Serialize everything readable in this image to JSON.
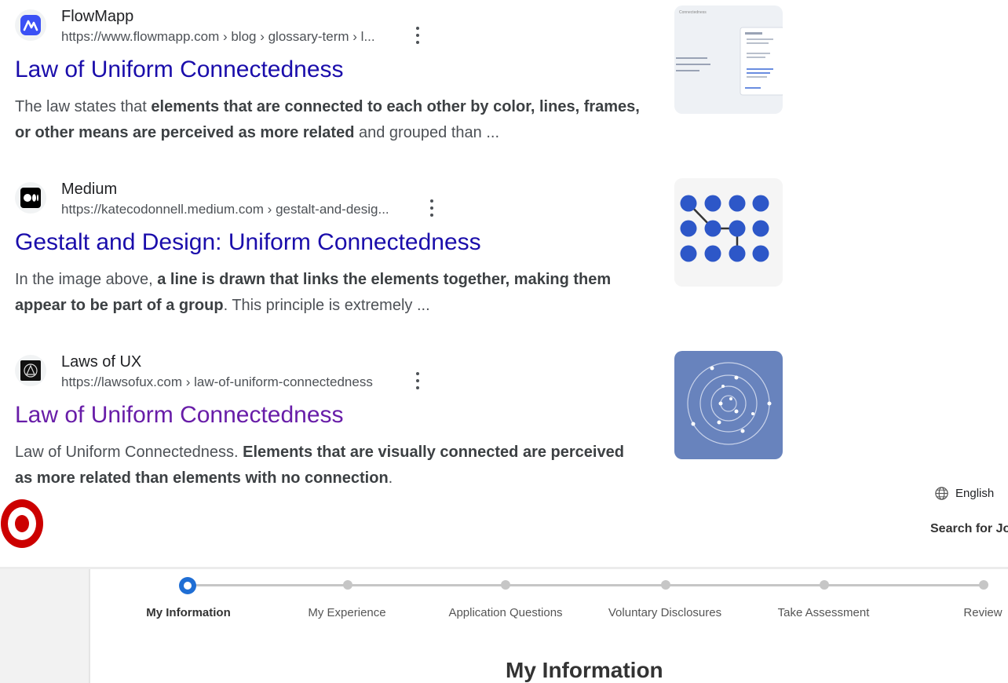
{
  "results": [
    {
      "site_name": "FlowMapp",
      "url": "https://www.flowmapp.com › blog › glossary-term › l...",
      "title": "Law of Uniform Connectedness",
      "snippet": [
        {
          "text": "The law states that ",
          "bold": false
        },
        {
          "text": "elements that are connected to each other by color, lines, frames, or other means are perceived as more related",
          "bold": true
        },
        {
          "text": " and grouped than ...",
          "bold": false
        }
      ],
      "thumb_label": "Connectedness",
      "favicon": "flowmapp-logo-icon",
      "thumbnail": "ui-notifications-screenshot"
    },
    {
      "site_name": "Medium",
      "url": "https://katecodonnell.medium.com › gestalt-and-desig...",
      "title": "Gestalt and Design: Uniform Connectedness",
      "snippet": [
        {
          "text": "In the image above, ",
          "bold": false
        },
        {
          "text": "a line is drawn that links the elements together, making them appear to be part of a group",
          "bold": true
        },
        {
          "text": ". This principle is extremely ...",
          "bold": false
        }
      ],
      "favicon": "medium-logo-icon",
      "thumbnail": "connected-dots-grid"
    },
    {
      "site_name": "Laws of UX",
      "url": "https://lawsofux.com › law-of-uniform-connectedness",
      "title": "Law of Uniform Connectedness",
      "snippet": [
        {
          "text": "Law of Uniform Connectedness. ",
          "bold": false
        },
        {
          "text": "Elements that are visually connected are perceived as more related than elements with no connection",
          "bold": true
        },
        {
          "text": ".",
          "bold": false
        }
      ],
      "favicon": "lawsofux-logo-icon",
      "thumbnail": "concentric-orbits"
    }
  ],
  "language": "English",
  "search_jobs": "Search for Jo",
  "steps": [
    {
      "label": "My Information",
      "active": true
    },
    {
      "label": "My Experience",
      "active": false
    },
    {
      "label": "Application Questions",
      "active": false
    },
    {
      "label": "Voluntary Disclosures",
      "active": false
    },
    {
      "label": "Take Assessment",
      "active": false
    },
    {
      "label": "Review",
      "active": false
    }
  ],
  "section_title": "My Information",
  "colors": {
    "link": "#1a0dab",
    "visited_link": "#681da8",
    "snippet": "#4d5156",
    "step_active": "#1f6ed4",
    "step_inactive": "#c6c6c6",
    "target_red": "#cc0000",
    "thumb_dots": "#2d57c8",
    "thumb_orbit_bg": "#6883bd"
  }
}
